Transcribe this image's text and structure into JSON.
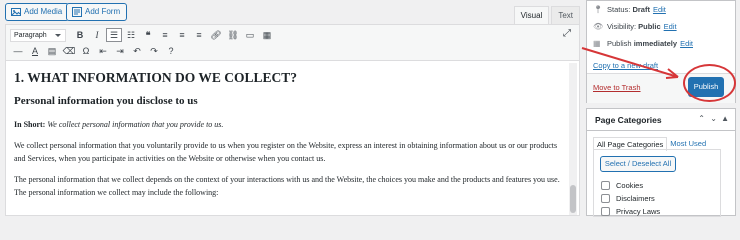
{
  "media": {
    "add_media": "Add Media",
    "add_form": "Add Form"
  },
  "editor_tabs": {
    "visual": "Visual",
    "text": "Text"
  },
  "toolbar": {
    "format": "Paragraph"
  },
  "content": {
    "heading": "1. WHAT INFORMATION DO WE COLLECT?",
    "subheading": "Personal information you disclose to us",
    "short_label": "In Short:",
    "short_text": "We collect personal information that you provide to us.",
    "p1": "We collect personal information that you voluntarily provide to us when you register on the Website, express an interest in obtaining information about us or our products and Services, when you participate in activities on the Website or otherwise when you contact us.",
    "p2": "The personal information that we collect depends on the context of your interactions with us and the Website, the choices you make and the products and features you use. The personal information we collect may include the following:"
  },
  "publish": {
    "status_label": "Status:",
    "status_value": "Draft",
    "visibility_label": "Visibility:",
    "visibility_value": "Public",
    "publish_label": "Publish",
    "publish_value": "immediately",
    "edit": "Edit",
    "copy_draft": "Copy to a new draft",
    "move_trash": "Move to Trash",
    "publish_button": "Publish"
  },
  "categories": {
    "title": "Page Categories",
    "tab_all": "All Page Categories",
    "tab_most": "Most Used",
    "select_all": "Select / Deselect All",
    "items": [
      "Cookies",
      "Disclaimers",
      "Privacy Laws"
    ]
  },
  "colors": {
    "accent": "#2271b1",
    "annotation": "#d63638",
    "trash": "#b32d2e"
  }
}
